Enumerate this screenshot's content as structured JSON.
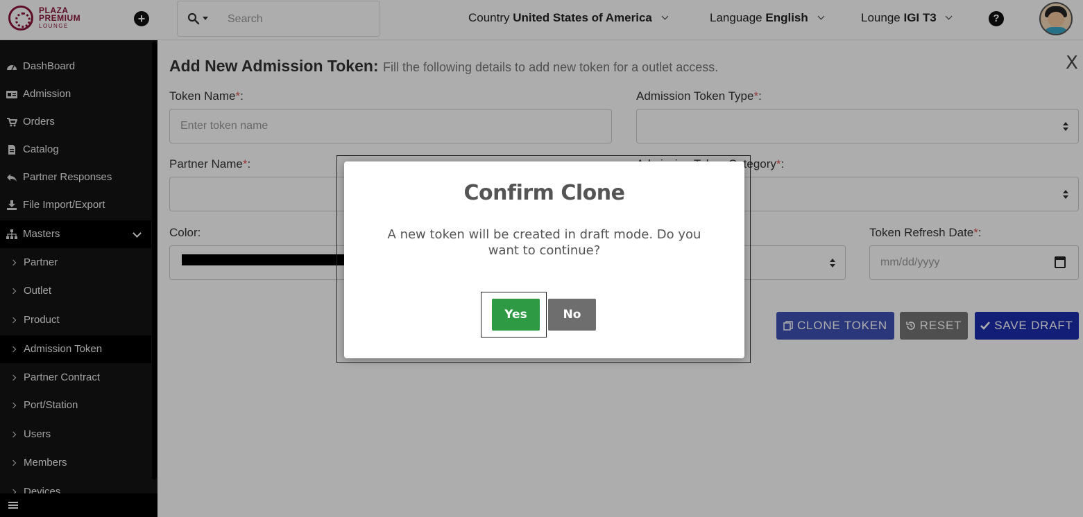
{
  "brand": {
    "name_line1": "PLAZA",
    "name_line2": "PREMIUM",
    "name_line3": "LOUNGE"
  },
  "header": {
    "search_placeholder": "Search",
    "country_label": "Country",
    "country_value": "United States of America",
    "language_label": "Language",
    "language_value": "English",
    "lounge_label": "Lounge",
    "lounge_value": "IGI T3"
  },
  "sidebar": {
    "items": [
      {
        "label": "DashBoard",
        "icon": "dashboard-icon"
      },
      {
        "label": "Admission",
        "icon": "id-card-icon"
      },
      {
        "label": "Orders",
        "icon": "cart-icon"
      },
      {
        "label": "Catalog",
        "icon": "file-icon"
      },
      {
        "label": "Partner Responses",
        "icon": "reply-icon"
      },
      {
        "label": "File Import/Export",
        "icon": "download-icon"
      },
      {
        "label": "Masters",
        "icon": "sitemap-icon"
      }
    ],
    "sub_items": [
      {
        "label": "Partner"
      },
      {
        "label": "Outlet"
      },
      {
        "label": "Product"
      },
      {
        "label": "Admission Token",
        "active": true
      },
      {
        "label": "Partner Contract"
      },
      {
        "label": "Port/Station"
      },
      {
        "label": "Users"
      },
      {
        "label": "Members"
      },
      {
        "label": "Devices"
      }
    ]
  },
  "form": {
    "title": "Add New Admission Token:",
    "description": "Fill the following details to add new token for a outlet access.",
    "close_label": "X",
    "token_name_label": "Token Name",
    "token_name_placeholder": "Enter token name",
    "token_type_label": "Admission Token Type",
    "partner_name_label": "Partner Name",
    "token_category_label": "Admission Token Category",
    "color_label": "Color",
    "refresh_date_label": "Token Refresh Date",
    "refresh_date_placeholder": "mm/dd/yyyy",
    "required_mark": "*",
    "colon": ":"
  },
  "actions": {
    "clone": "CLONE TOKEN",
    "reset": "RESET",
    "save": "SAVE DRAFT"
  },
  "modal": {
    "title": "Confirm Clone",
    "text": "A new token will be created in draft mode. Do you want to continue?",
    "yes": "Yes",
    "no": "No"
  },
  "colors": {
    "brand": "#8a1538",
    "clone": "#3f51b5",
    "reset": "#757575",
    "save": "#1d2eb0",
    "yes": "#2e9a43",
    "no": "#6e6e6e",
    "required": "#d9534f",
    "token_color": "#000000"
  }
}
